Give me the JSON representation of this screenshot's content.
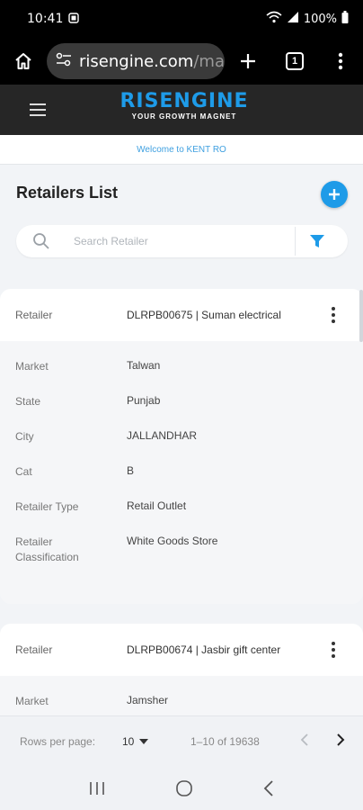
{
  "status": {
    "time": "10:41",
    "battery": "100%"
  },
  "browser": {
    "url_main": "risengine.com",
    "url_rest": "/mas",
    "tab_count": "1"
  },
  "app": {
    "logo_text": "RISENGINE",
    "logo_tagline": "YOUR GROWTH MAGNET",
    "welcome": "Welcome to KENT RO"
  },
  "page": {
    "title": "Retailers List",
    "search_placeholder": "Search Retailer",
    "accent_color": "#1e9be8"
  },
  "retailers": [
    {
      "head_label": "Retailer",
      "head_value": "DLRPB00675 | Suman electrical",
      "rows": [
        {
          "label": "Market",
          "value": "Talwan"
        },
        {
          "label": "State",
          "value": "Punjab"
        },
        {
          "label": "City",
          "value": "JALLANDHAR"
        },
        {
          "label": "Cat",
          "value": "B"
        },
        {
          "label": "Retailer Type",
          "value": "Retail Outlet"
        },
        {
          "label": "Retailer Classification",
          "value": "White Goods Store"
        }
      ]
    },
    {
      "head_label": "Retailer",
      "head_value": "DLRPB00674 | Jasbir gift center",
      "rows": [
        {
          "label": "Market",
          "value": "Jamsher"
        }
      ]
    }
  ],
  "pagination": {
    "rows_label": "Rows per page:",
    "rows_value": "10",
    "range": "1–10 of 19638"
  }
}
